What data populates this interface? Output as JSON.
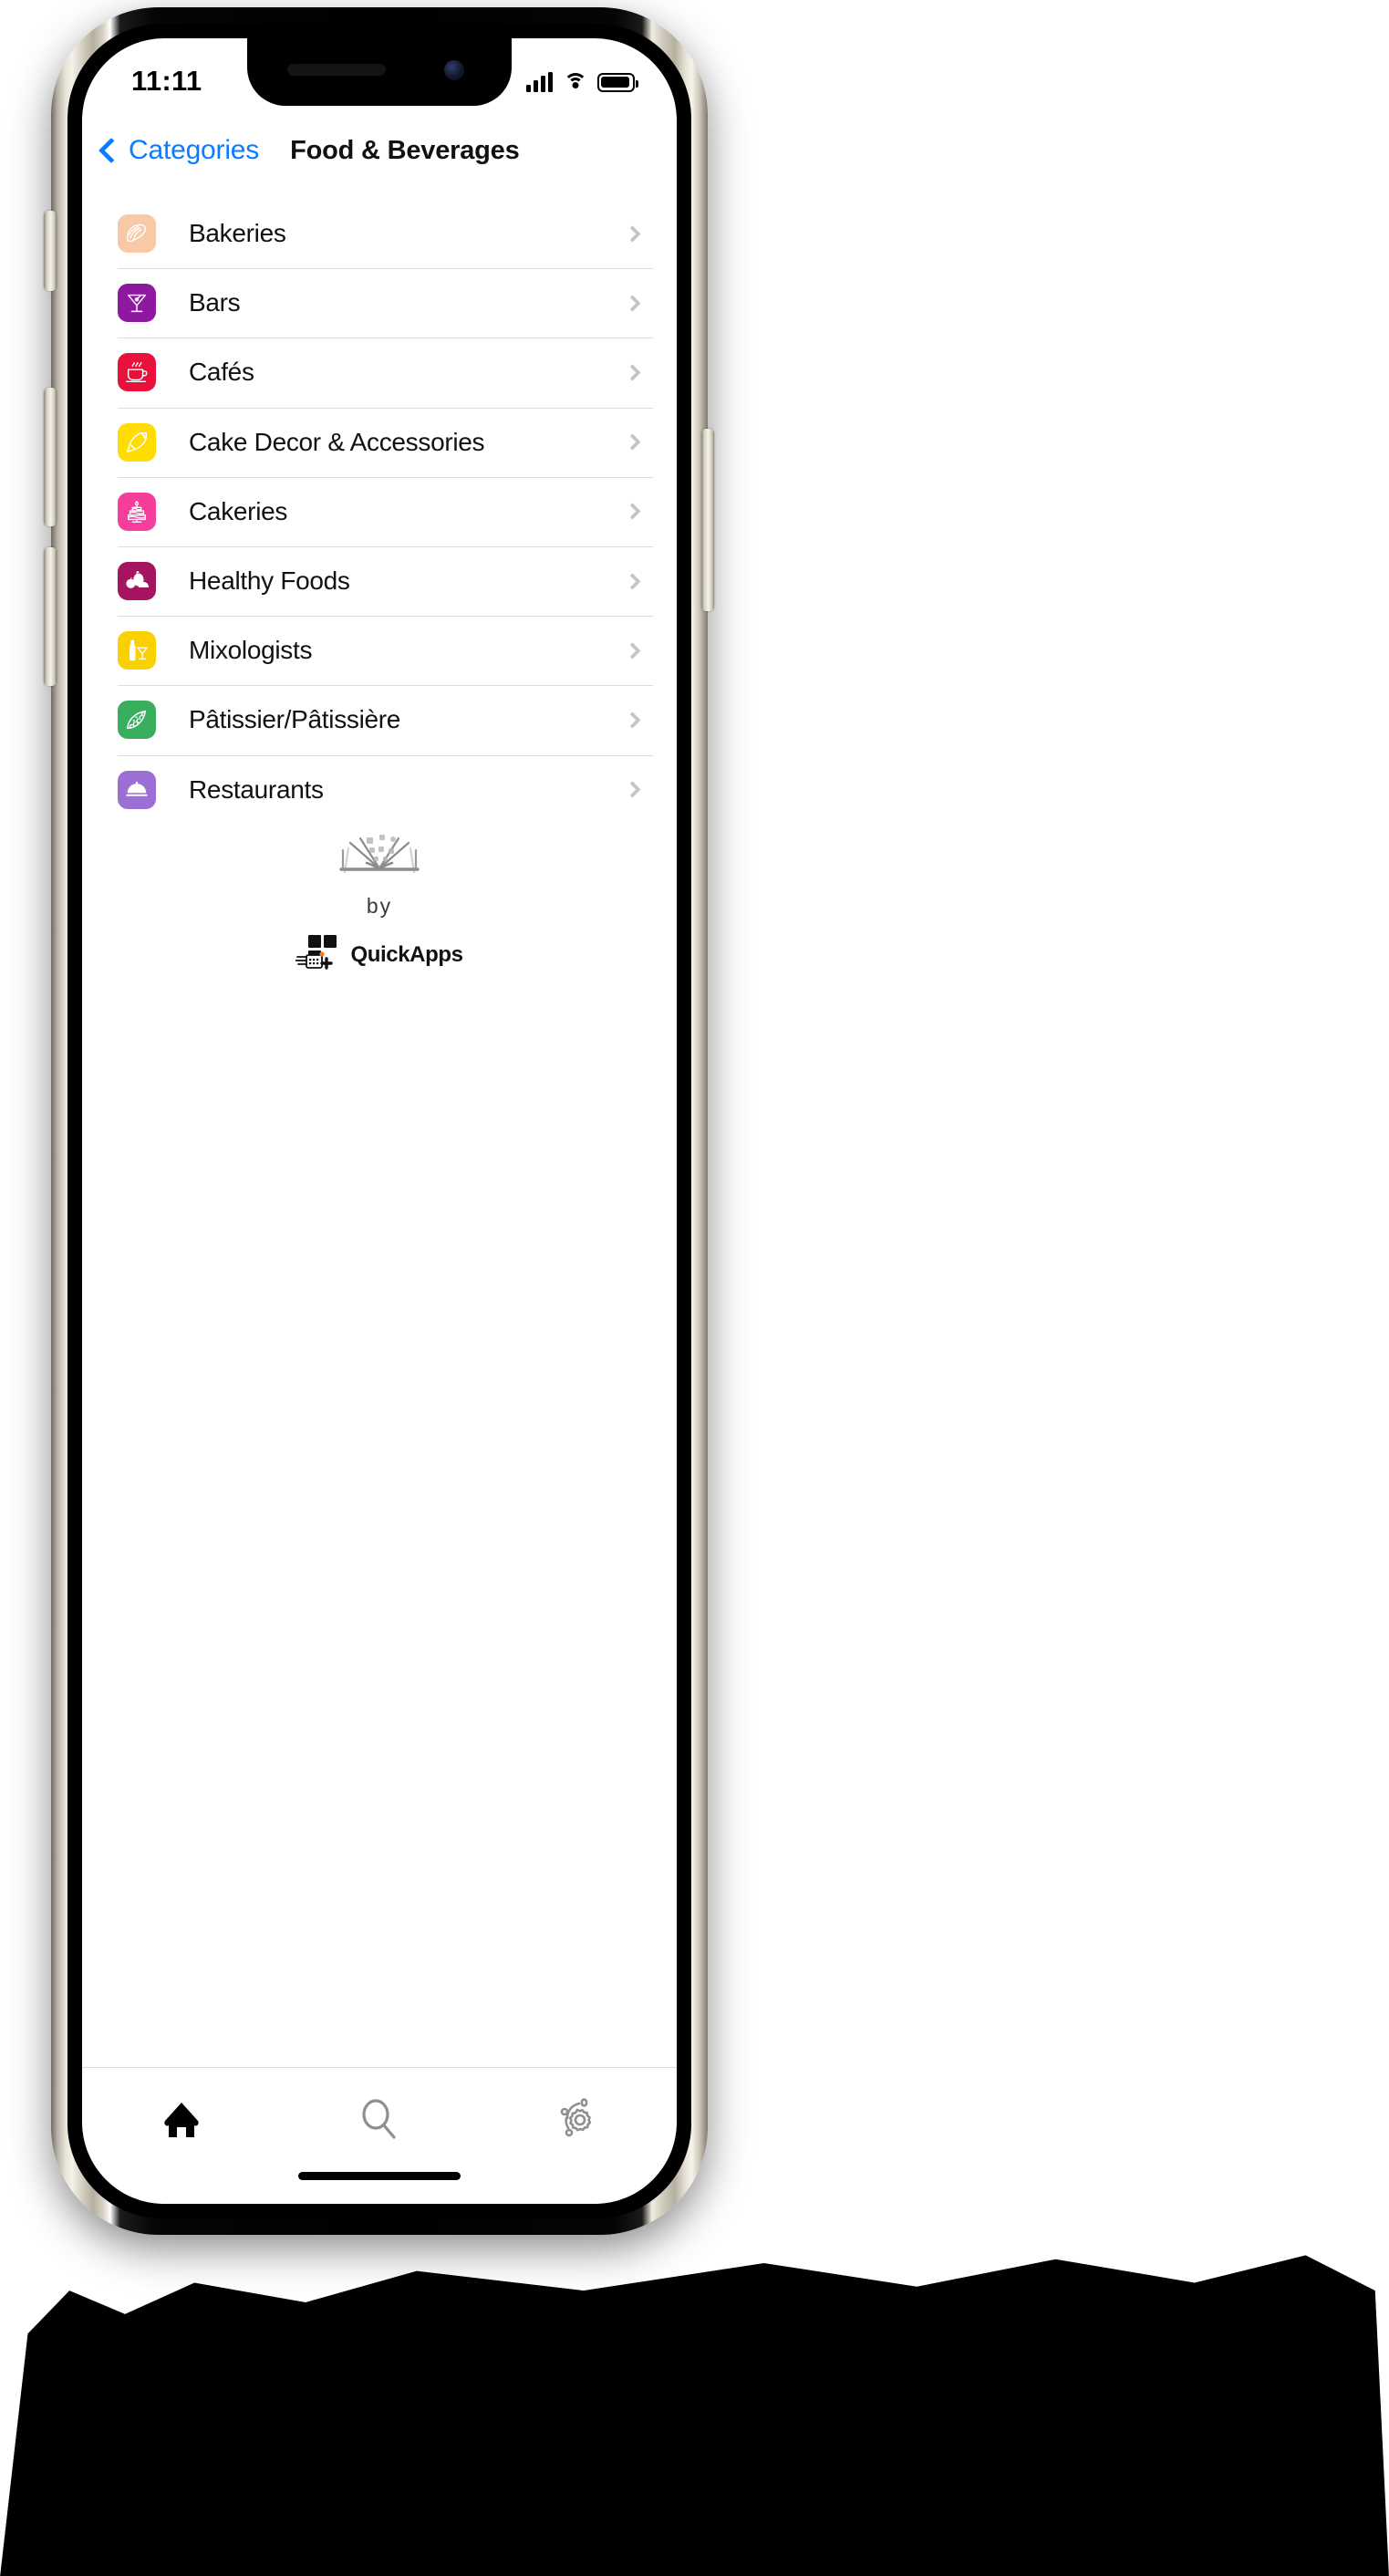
{
  "device": {
    "frame_color": "#e8e4d8",
    "bezel_color": "#000000"
  },
  "status_bar": {
    "time": "11:11",
    "signal_icon": "cellular-bars-icon",
    "wifi_icon": "wifi-icon",
    "battery_icon": "battery-full-icon"
  },
  "nav": {
    "back_label": "Categories",
    "back_icon": "chevron-left-icon",
    "title": "Food & Beverages",
    "accent_color": "#0A7CFF"
  },
  "list": {
    "disclosure_icon": "chevron-right-icon",
    "disclosure_color": "#C5C5C8",
    "items": [
      {
        "label": "Bakeries",
        "icon": "croissant-icon",
        "tile_color": "#F7C9A6",
        "glyph_color": "#FFFFFF"
      },
      {
        "label": "Bars",
        "icon": "martini-glass-icon",
        "tile_color": "#8E189F",
        "glyph_color": "#FFFFFF"
      },
      {
        "label": "Cafés",
        "icon": "coffee-cup-icon",
        "tile_color": "#E8113C",
        "glyph_color": "#FFFFFF"
      },
      {
        "label": "Cake Decor & Accessories",
        "icon": "piping-bag-icon",
        "tile_color": "#FFDD00",
        "glyph_color": "#FFFFFF"
      },
      {
        "label": "Cakeries",
        "icon": "tiered-cake-icon",
        "tile_color": "#F53E9C",
        "glyph_color": "#FFFFFF"
      },
      {
        "label": "Healthy Foods",
        "icon": "fruit-basket-icon",
        "tile_color": "#A5155F",
        "glyph_color": "#FFFFFF"
      },
      {
        "label": "Mixologists",
        "icon": "bottle-glass-icon",
        "tile_color": "#F9D100",
        "glyph_color": "#FFFFFF"
      },
      {
        "label": "Pâtissier/Pâtissière",
        "icon": "pastry-icon",
        "tile_color": "#39AE5E",
        "glyph_color": "#FFFFFF"
      },
      {
        "label": "Restaurants",
        "icon": "cloche-icon",
        "tile_color": "#9B6FD4",
        "glyph_color": "#FFFFFF"
      }
    ]
  },
  "branding": {
    "book_icon": "open-book-icon",
    "by_label": "by",
    "company": "QuickApps",
    "company_mark_icon": "quickapps-blocks-icon"
  },
  "tab_bar": {
    "tabs": [
      {
        "name": "home",
        "icon": "home-icon",
        "active": true,
        "color": "#000000"
      },
      {
        "name": "search",
        "icon": "search-icon",
        "active": false,
        "color": "#8E8E93"
      },
      {
        "name": "settings",
        "icon": "gear-icon",
        "active": false,
        "color": "#8E8E93"
      }
    ]
  }
}
